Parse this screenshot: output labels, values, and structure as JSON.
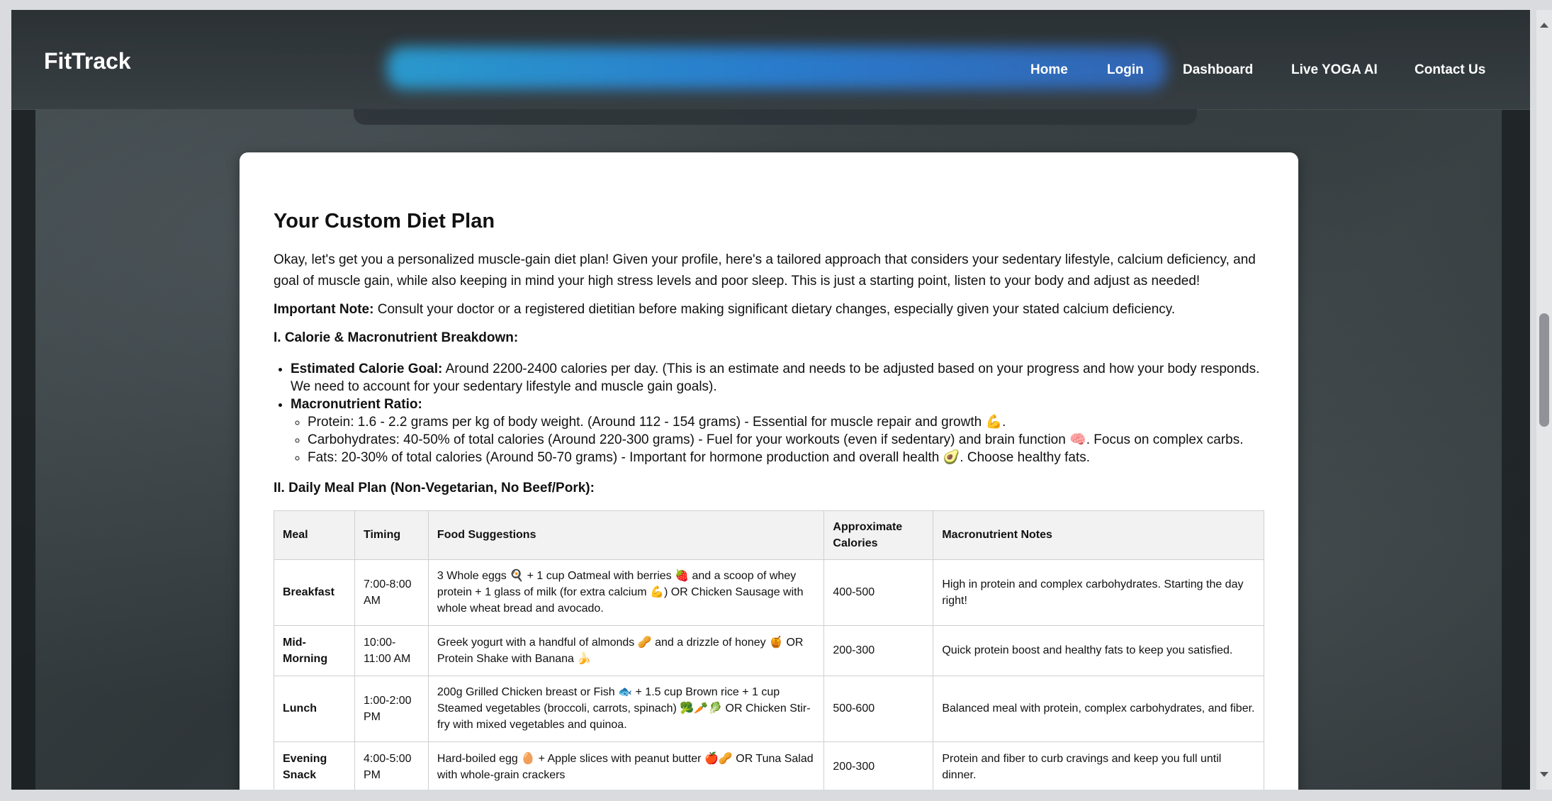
{
  "nav": {
    "brand": "FitTrack",
    "links": [
      "Home",
      "Login",
      "Dashboard",
      "Live YOGA AI",
      "Contact Us"
    ]
  },
  "plan": {
    "title": "Your Custom Diet Plan",
    "intro": "Okay, let's get you a personalized muscle-gain diet plan! Given your profile, here's a tailored approach that considers your sedentary lifestyle, calcium deficiency, and goal of muscle gain, while also keeping in mind your high stress levels and poor sleep. This is just a starting point, listen to your body and adjust as needed!",
    "note_label": "Important Note:",
    "note_text": " Consult your doctor or a registered dietitian before making significant dietary changes, especially given your stated calcium deficiency.",
    "section1": "I. Calorie & Macronutrient Breakdown:",
    "calorie_label": "Estimated Calorie Goal:",
    "calorie_text": " Around 2200-2400 calories per day. (This is an estimate and needs to be adjusted based on your progress and how your body responds. We need to account for your sedentary lifestyle and muscle gain goals).",
    "macro_label": "Macronutrient Ratio:",
    "macros": [
      "Protein: 1.6 - 2.2 grams per kg of body weight. (Around 112 - 154 grams) - Essential for muscle repair and growth 💪.",
      "Carbohydrates: 40-50% of total calories (Around 220-300 grams) - Fuel for your workouts (even if sedentary) and brain function 🧠. Focus on complex carbs.",
      "Fats: 20-30% of total calories (Around 50-70 grams) - Important for hormone production and overall health 🥑. Choose healthy fats."
    ],
    "section2": "II. Daily Meal Plan (Non-Vegetarian, No Beef/Pork):",
    "table": {
      "headers": [
        "Meal",
        "Timing",
        "Food Suggestions",
        "Approximate Calories",
        "Macronutrient Notes"
      ],
      "rows": [
        [
          "Breakfast",
          "7:00-8:00 AM",
          "3 Whole eggs 🍳 + 1 cup Oatmeal with berries 🍓 and a scoop of whey protein + 1 glass of milk (for extra calcium 💪) OR Chicken Sausage with whole wheat bread and avocado.",
          "400-500",
          "High in protein and complex carbohydrates. Starting the day right!"
        ],
        [
          "Mid-Morning",
          "10:00-11:00 AM",
          "Greek yogurt with a handful of almonds 🥜 and a drizzle of honey 🍯 OR Protein Shake with Banana 🍌",
          "200-300",
          "Quick protein boost and healthy fats to keep you satisfied."
        ],
        [
          "Lunch",
          "1:00-2:00 PM",
          "200g Grilled Chicken breast or Fish 🐟 + 1.5 cup Brown rice + 1 cup Steamed vegetables (broccoli, carrots, spinach) 🥦🥕🥬 OR Chicken Stir-fry with mixed vegetables and quinoa.",
          "500-600",
          "Balanced meal with protein, complex carbohydrates, and fiber."
        ],
        [
          "Evening Snack",
          "4:00-5:00 PM",
          "Hard-boiled egg 🥚 + Apple slices with peanut butter 🍎🥜 OR Tuna Salad with whole-grain crackers",
          "200-300",
          "Protein and fiber to curb cravings and keep you full until dinner."
        ]
      ]
    }
  }
}
